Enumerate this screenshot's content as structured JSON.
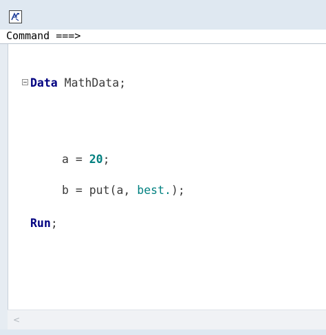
{
  "command_bar": {
    "label": "Command ===>"
  },
  "editor": {
    "lines": [
      {
        "keyword": "Data",
        "rest": " MathData;"
      },
      {
        "prefix": "a = ",
        "number": "20",
        "suffix": ";"
      },
      {
        "prefix": "b = put(a, ",
        "format": "best.",
        "suffix": ");"
      },
      {
        "keyword": "Run",
        "suffix": ";"
      }
    ]
  },
  "scrollbar": {
    "left_arrow": "<"
  },
  "icons": {
    "app": "sas-program-icon",
    "fold": "collapse-minus-icon"
  }
}
